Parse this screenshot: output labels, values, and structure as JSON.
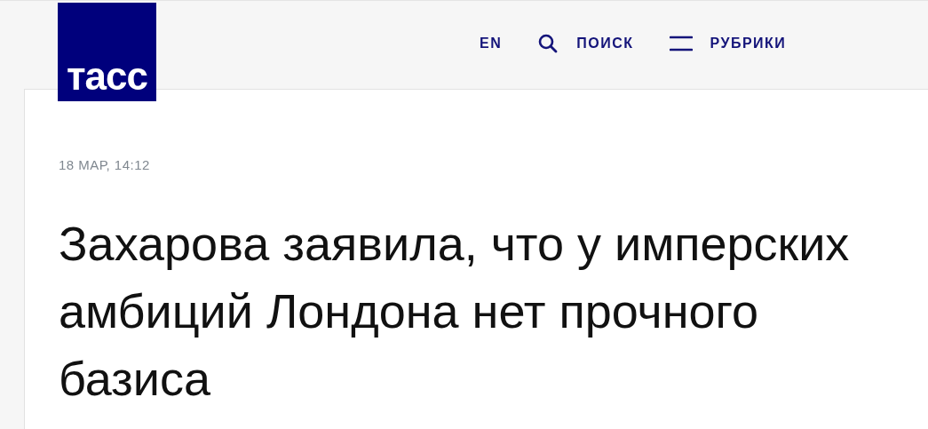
{
  "logo": {
    "text": "тасс"
  },
  "nav": [
    {
      "kind": "lang",
      "label": "EN"
    },
    {
      "kind": "search",
      "label": "ПОИСК"
    },
    {
      "kind": "menu",
      "label": "РУБРИКИ"
    }
  ],
  "article": {
    "date": "18 МАР, 14:12",
    "headline": "Захарова заявила, что у имперских амбиций Лондона нет прочного базиса"
  }
}
